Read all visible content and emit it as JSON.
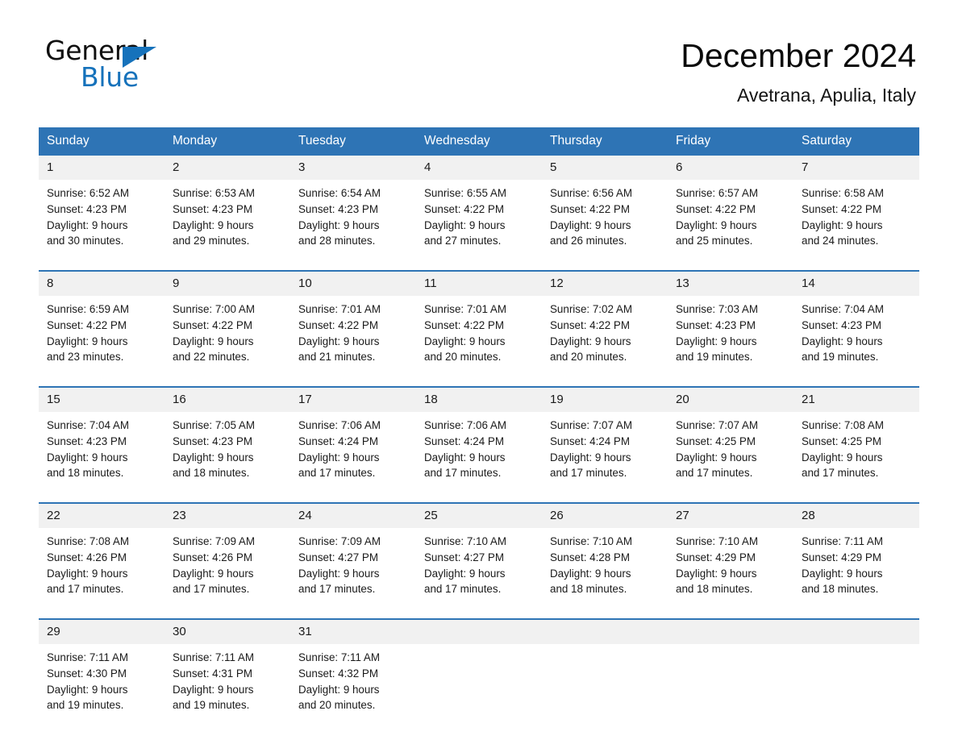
{
  "brand": {
    "name_part1": "General",
    "name_part2": "Blue",
    "accent_color": "#1672bb"
  },
  "header": {
    "title": "December 2024",
    "location": "Avetrana, Apulia, Italy"
  },
  "theme": {
    "header_row_bg": "#2e74b5",
    "daynum_bg": "#f1f1f1",
    "page_bg": "#ffffff",
    "text_color": "#1a1a1a"
  },
  "weekday_headers": [
    "Sunday",
    "Monday",
    "Tuesday",
    "Wednesday",
    "Thursday",
    "Friday",
    "Saturday"
  ],
  "labels": {
    "sunrise_prefix": "Sunrise:",
    "sunset_prefix": "Sunset:",
    "daylight_prefix": "Daylight:"
  },
  "weeks": [
    [
      {
        "day": "1",
        "sunrise": "Sunrise: 6:52 AM",
        "sunset": "Sunset: 4:23 PM",
        "daylight_line1": "Daylight: 9 hours",
        "daylight_line2": "and 30 minutes."
      },
      {
        "day": "2",
        "sunrise": "Sunrise: 6:53 AM",
        "sunset": "Sunset: 4:23 PM",
        "daylight_line1": "Daylight: 9 hours",
        "daylight_line2": "and 29 minutes."
      },
      {
        "day": "3",
        "sunrise": "Sunrise: 6:54 AM",
        "sunset": "Sunset: 4:23 PM",
        "daylight_line1": "Daylight: 9 hours",
        "daylight_line2": "and 28 minutes."
      },
      {
        "day": "4",
        "sunrise": "Sunrise: 6:55 AM",
        "sunset": "Sunset: 4:22 PM",
        "daylight_line1": "Daylight: 9 hours",
        "daylight_line2": "and 27 minutes."
      },
      {
        "day": "5",
        "sunrise": "Sunrise: 6:56 AM",
        "sunset": "Sunset: 4:22 PM",
        "daylight_line1": "Daylight: 9 hours",
        "daylight_line2": "and 26 minutes."
      },
      {
        "day": "6",
        "sunrise": "Sunrise: 6:57 AM",
        "sunset": "Sunset: 4:22 PM",
        "daylight_line1": "Daylight: 9 hours",
        "daylight_line2": "and 25 minutes."
      },
      {
        "day": "7",
        "sunrise": "Sunrise: 6:58 AM",
        "sunset": "Sunset: 4:22 PM",
        "daylight_line1": "Daylight: 9 hours",
        "daylight_line2": "and 24 minutes."
      }
    ],
    [
      {
        "day": "8",
        "sunrise": "Sunrise: 6:59 AM",
        "sunset": "Sunset: 4:22 PM",
        "daylight_line1": "Daylight: 9 hours",
        "daylight_line2": "and 23 minutes."
      },
      {
        "day": "9",
        "sunrise": "Sunrise: 7:00 AM",
        "sunset": "Sunset: 4:22 PM",
        "daylight_line1": "Daylight: 9 hours",
        "daylight_line2": "and 22 minutes."
      },
      {
        "day": "10",
        "sunrise": "Sunrise: 7:01 AM",
        "sunset": "Sunset: 4:22 PM",
        "daylight_line1": "Daylight: 9 hours",
        "daylight_line2": "and 21 minutes."
      },
      {
        "day": "11",
        "sunrise": "Sunrise: 7:01 AM",
        "sunset": "Sunset: 4:22 PM",
        "daylight_line1": "Daylight: 9 hours",
        "daylight_line2": "and 20 minutes."
      },
      {
        "day": "12",
        "sunrise": "Sunrise: 7:02 AM",
        "sunset": "Sunset: 4:22 PM",
        "daylight_line1": "Daylight: 9 hours",
        "daylight_line2": "and 20 minutes."
      },
      {
        "day": "13",
        "sunrise": "Sunrise: 7:03 AM",
        "sunset": "Sunset: 4:23 PM",
        "daylight_line1": "Daylight: 9 hours",
        "daylight_line2": "and 19 minutes."
      },
      {
        "day": "14",
        "sunrise": "Sunrise: 7:04 AM",
        "sunset": "Sunset: 4:23 PM",
        "daylight_line1": "Daylight: 9 hours",
        "daylight_line2": "and 19 minutes."
      }
    ],
    [
      {
        "day": "15",
        "sunrise": "Sunrise: 7:04 AM",
        "sunset": "Sunset: 4:23 PM",
        "daylight_line1": "Daylight: 9 hours",
        "daylight_line2": "and 18 minutes."
      },
      {
        "day": "16",
        "sunrise": "Sunrise: 7:05 AM",
        "sunset": "Sunset: 4:23 PM",
        "daylight_line1": "Daylight: 9 hours",
        "daylight_line2": "and 18 minutes."
      },
      {
        "day": "17",
        "sunrise": "Sunrise: 7:06 AM",
        "sunset": "Sunset: 4:24 PM",
        "daylight_line1": "Daylight: 9 hours",
        "daylight_line2": "and 17 minutes."
      },
      {
        "day": "18",
        "sunrise": "Sunrise: 7:06 AM",
        "sunset": "Sunset: 4:24 PM",
        "daylight_line1": "Daylight: 9 hours",
        "daylight_line2": "and 17 minutes."
      },
      {
        "day": "19",
        "sunrise": "Sunrise: 7:07 AM",
        "sunset": "Sunset: 4:24 PM",
        "daylight_line1": "Daylight: 9 hours",
        "daylight_line2": "and 17 minutes."
      },
      {
        "day": "20",
        "sunrise": "Sunrise: 7:07 AM",
        "sunset": "Sunset: 4:25 PM",
        "daylight_line1": "Daylight: 9 hours",
        "daylight_line2": "and 17 minutes."
      },
      {
        "day": "21",
        "sunrise": "Sunrise: 7:08 AM",
        "sunset": "Sunset: 4:25 PM",
        "daylight_line1": "Daylight: 9 hours",
        "daylight_line2": "and 17 minutes."
      }
    ],
    [
      {
        "day": "22",
        "sunrise": "Sunrise: 7:08 AM",
        "sunset": "Sunset: 4:26 PM",
        "daylight_line1": "Daylight: 9 hours",
        "daylight_line2": "and 17 minutes."
      },
      {
        "day": "23",
        "sunrise": "Sunrise: 7:09 AM",
        "sunset": "Sunset: 4:26 PM",
        "daylight_line1": "Daylight: 9 hours",
        "daylight_line2": "and 17 minutes."
      },
      {
        "day": "24",
        "sunrise": "Sunrise: 7:09 AM",
        "sunset": "Sunset: 4:27 PM",
        "daylight_line1": "Daylight: 9 hours",
        "daylight_line2": "and 17 minutes."
      },
      {
        "day": "25",
        "sunrise": "Sunrise: 7:10 AM",
        "sunset": "Sunset: 4:27 PM",
        "daylight_line1": "Daylight: 9 hours",
        "daylight_line2": "and 17 minutes."
      },
      {
        "day": "26",
        "sunrise": "Sunrise: 7:10 AM",
        "sunset": "Sunset: 4:28 PM",
        "daylight_line1": "Daylight: 9 hours",
        "daylight_line2": "and 18 minutes."
      },
      {
        "day": "27",
        "sunrise": "Sunrise: 7:10 AM",
        "sunset": "Sunset: 4:29 PM",
        "daylight_line1": "Daylight: 9 hours",
        "daylight_line2": "and 18 minutes."
      },
      {
        "day": "28",
        "sunrise": "Sunrise: 7:11 AM",
        "sunset": "Sunset: 4:29 PM",
        "daylight_line1": "Daylight: 9 hours",
        "daylight_line2": "and 18 minutes."
      }
    ],
    [
      {
        "day": "29",
        "sunrise": "Sunrise: 7:11 AM",
        "sunset": "Sunset: 4:30 PM",
        "daylight_line1": "Daylight: 9 hours",
        "daylight_line2": "and 19 minutes."
      },
      {
        "day": "30",
        "sunrise": "Sunrise: 7:11 AM",
        "sunset": "Sunset: 4:31 PM",
        "daylight_line1": "Daylight: 9 hours",
        "daylight_line2": "and 19 minutes."
      },
      {
        "day": "31",
        "sunrise": "Sunrise: 7:11 AM",
        "sunset": "Sunset: 4:32 PM",
        "daylight_line1": "Daylight: 9 hours",
        "daylight_line2": "and 20 minutes."
      },
      {
        "day": "",
        "sunrise": "",
        "sunset": "",
        "daylight_line1": "",
        "daylight_line2": ""
      },
      {
        "day": "",
        "sunrise": "",
        "sunset": "",
        "daylight_line1": "",
        "daylight_line2": ""
      },
      {
        "day": "",
        "sunrise": "",
        "sunset": "",
        "daylight_line1": "",
        "daylight_line2": ""
      },
      {
        "day": "",
        "sunrise": "",
        "sunset": "",
        "daylight_line1": "",
        "daylight_line2": ""
      }
    ]
  ]
}
